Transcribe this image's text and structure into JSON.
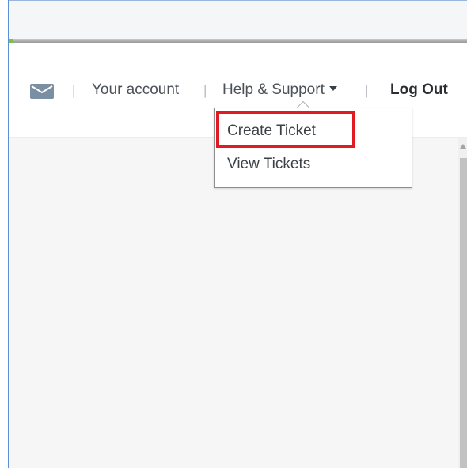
{
  "progress": {
    "fill_fraction": 0.01,
    "color": "#7cc242"
  },
  "header": {
    "separator": "|",
    "mail_icon": "envelope-icon",
    "your_account": "Your account",
    "help_support": "Help & Support",
    "help_caret_icon": "caret-down-icon",
    "logout": "Log Out"
  },
  "dropdown": {
    "items": [
      {
        "label": "Create Ticket",
        "highlighted": true
      },
      {
        "label": "View Tickets",
        "highlighted": false
      }
    ],
    "highlight_color": "#e01b24"
  },
  "colors": {
    "nav_text": "#4b5157",
    "logout_text": "#2b2f33",
    "content_background": "#f6f6f6",
    "mail_icon": "#7a8fa3"
  }
}
